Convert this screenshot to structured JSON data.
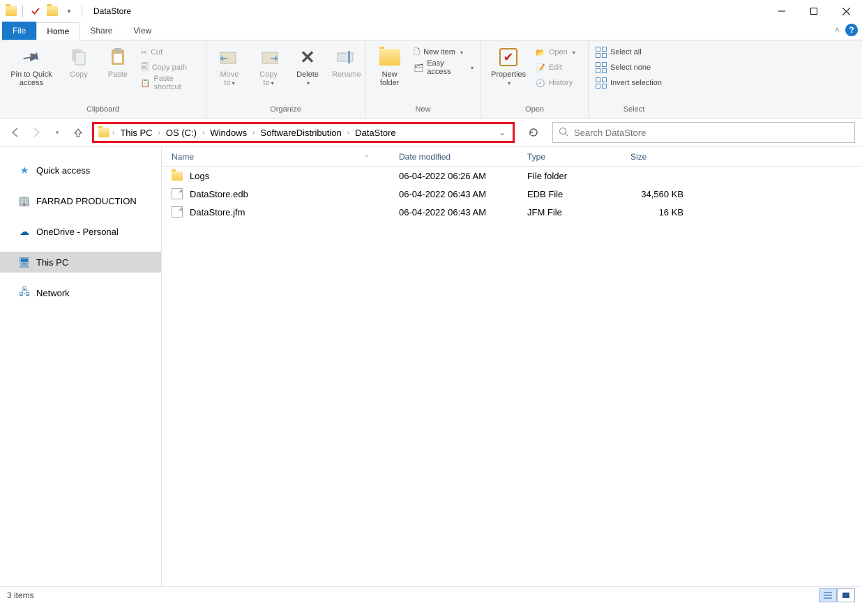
{
  "window": {
    "title": "DataStore"
  },
  "tabs": {
    "file": "File",
    "home": "Home",
    "share": "Share",
    "view": "View"
  },
  "ribbon": {
    "clipboard": {
      "label": "Clipboard",
      "pin": "Pin to Quick access",
      "copy": "Copy",
      "paste": "Paste",
      "cut": "Cut",
      "copy_path": "Copy path",
      "paste_shortcut": "Paste shortcut"
    },
    "organize": {
      "label": "Organize",
      "move_to": "Move to",
      "copy_to": "Copy to",
      "delete": "Delete",
      "rename": "Rename"
    },
    "new": {
      "label": "New",
      "new_folder": "New folder",
      "new_item": "New item",
      "easy_access": "Easy access"
    },
    "open": {
      "label": "Open",
      "properties": "Properties",
      "open": "Open",
      "edit": "Edit",
      "history": "History"
    },
    "select": {
      "label": "Select",
      "select_all": "Select all",
      "select_none": "Select none",
      "invert": "Invert selection"
    }
  },
  "breadcrumb": {
    "items": [
      "This PC",
      "OS (C:)",
      "Windows",
      "SoftwareDistribution",
      "DataStore"
    ]
  },
  "search": {
    "placeholder": "Search DataStore"
  },
  "nav_pane": {
    "quick_access": "Quick access",
    "farrad": "FARRAD PRODUCTION",
    "onedrive": "OneDrive - Personal",
    "this_pc": "This PC",
    "network": "Network"
  },
  "columns": {
    "name": "Name",
    "date": "Date modified",
    "type": "Type",
    "size": "Size"
  },
  "files": [
    {
      "icon": "folder",
      "name": "Logs",
      "date": "06-04-2022 06:26 AM",
      "type": "File folder",
      "size": ""
    },
    {
      "icon": "file",
      "name": "DataStore.edb",
      "date": "06-04-2022 06:43 AM",
      "type": "EDB File",
      "size": "34,560 KB"
    },
    {
      "icon": "file",
      "name": "DataStore.jfm",
      "date": "06-04-2022 06:43 AM",
      "type": "JFM File",
      "size": "16 KB"
    }
  ],
  "status": {
    "items": "3 items"
  }
}
